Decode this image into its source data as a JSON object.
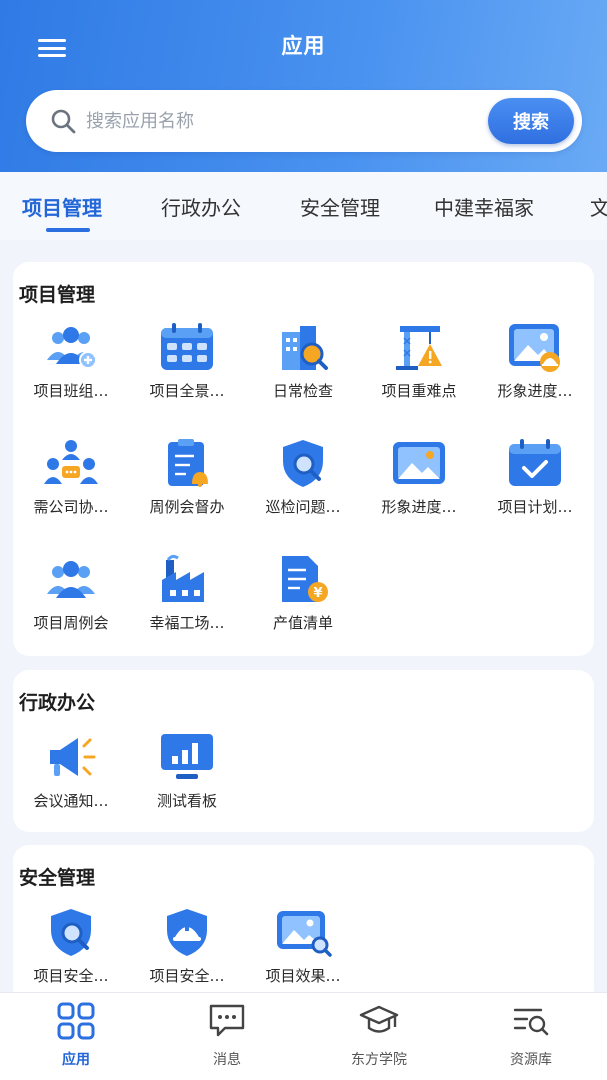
{
  "header": {
    "title": "应用"
  },
  "search": {
    "placeholder": "搜索应用名称",
    "button_label": "搜索"
  },
  "tabs": [
    "项目管理",
    "行政办公",
    "安全管理",
    "中建幸福家",
    "文"
  ],
  "sections": [
    {
      "title": "项目管理",
      "apps": [
        "项目班组…",
        "项目全景…",
        "日常检查",
        "项目重难点",
        "形象进度…",
        "需公司协…",
        "周例会督办",
        "巡检问题…",
        "形象进度…",
        "项目计划…",
        "项目周例会",
        "幸福工场…",
        "产值清单"
      ]
    },
    {
      "title": "行政办公",
      "apps": [
        "会议通知…",
        "测试看板"
      ]
    },
    {
      "title": "安全管理",
      "apps": [
        "项目安全…",
        "项目安全…",
        "项目效果…"
      ]
    }
  ],
  "bottom_nav": [
    "应用",
    "消息",
    "东方学院",
    "资源库"
  ],
  "colors": {
    "accent": "#2366d8",
    "header_start": "#2f7ae5",
    "header_end": "#6aaaf5"
  }
}
